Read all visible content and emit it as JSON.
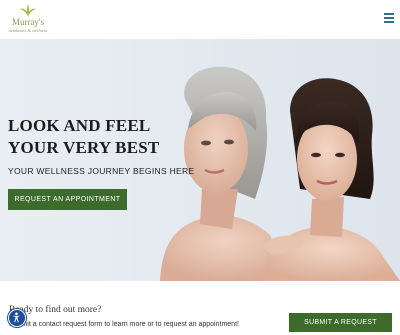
{
  "header": {
    "logo_name": "Murray's",
    "logo_tagline": "aesthetics & wellness",
    "menu_icon": "hamburger-menu-icon"
  },
  "hero": {
    "title_line1": "LOOK AND FEEL",
    "title_line2": "YOUR VERY BEST",
    "subtitle": "YOUR WELLNESS JOURNEY BEGINS HERE",
    "cta_label": "REQUEST AN APPOINTMENT"
  },
  "footer": {
    "heading": "Ready to find out more?",
    "text": "Submit a contact request form to learn more or to request an appointment!",
    "cta_label": "SUBMIT A REQUEST"
  },
  "accessibility": {
    "icon": "accessibility-icon"
  },
  "colors": {
    "brand_green": "#3c6b2c",
    "logo_green": "#8a9a5b",
    "menu_blue": "#2e6e8e",
    "accessibility_blue": "#1d4f9e",
    "hero_background": "#e4eaf0"
  }
}
